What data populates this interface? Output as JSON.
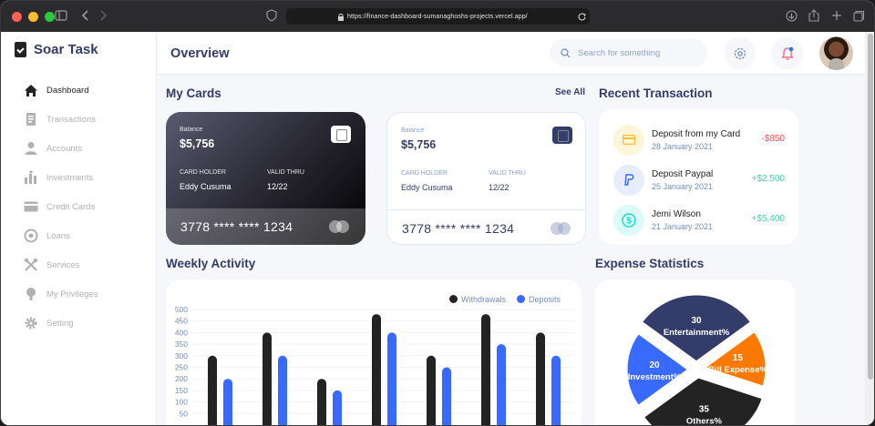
{
  "browser": {
    "url": "https://finance-dashboard-sumanaghoshs-projects.vercel.app/"
  },
  "sidebar": {
    "brand": "Soar Task",
    "items": [
      {
        "label": "Dashboard",
        "icon": "home-icon",
        "active": true
      },
      {
        "label": "Transactions",
        "icon": "transfer-icon",
        "active": false
      },
      {
        "label": "Accounts",
        "icon": "user-icon",
        "active": false
      },
      {
        "label": "Investments",
        "icon": "investment-icon",
        "active": false
      },
      {
        "label": "Credit Cards",
        "icon": "credit-card-icon",
        "active": false
      },
      {
        "label": "Loans",
        "icon": "loan-icon",
        "active": false
      },
      {
        "label": "Services",
        "icon": "services-icon",
        "active": false
      },
      {
        "label": "My Privileges",
        "icon": "privileges-icon",
        "active": false
      },
      {
        "label": "Setting",
        "icon": "gear-icon",
        "active": false
      }
    ]
  },
  "header": {
    "title": "Overview",
    "search_placeholder": "Search for something"
  },
  "my_cards": {
    "title": "My Cards",
    "see_all": "See All",
    "cards": [
      {
        "balance_label": "Balance",
        "balance": "$5,756",
        "holder_label": "CARD HOLDER",
        "holder": "Eddy Cusuma",
        "valid_label": "VALID THRU",
        "valid": "12/22",
        "number": "3778 **** **** 1234",
        "theme": "dark"
      },
      {
        "balance_label": "Balance",
        "balance": "$5,756",
        "holder_label": "CARD HOLDER",
        "holder": "Eddy Cusuma",
        "valid_label": "VALID THRU",
        "valid": "12/22",
        "number": "3778 **** **** 1234",
        "theme": "light"
      }
    ]
  },
  "recent_transactions": {
    "title": "Recent Transaction",
    "items": [
      {
        "name": "Deposit from my Card",
        "date": "28 January 2021",
        "amount": "-$850",
        "color": "#ff4b4a",
        "icon": "card-icon",
        "icon_bg": "#fff5d9"
      },
      {
        "name": "Deposit Paypal",
        "date": "25 January 2021",
        "amount": "+$2,500",
        "color": "#41d4a8",
        "icon": "paypal-icon",
        "icon_bg": "#e7edff"
      },
      {
        "name": "Jemi Wilson",
        "date": "21 January 2021",
        "amount": "+$5,400",
        "color": "#41d4a8",
        "icon": "dollar-icon",
        "icon_bg": "#dcfaf8"
      }
    ]
  },
  "weekly_activity": {
    "title": "Weekly Activity",
    "legend": [
      "Withdrawals",
      "Deposits"
    ],
    "colors": {
      "withdrawals": "#232323",
      "deposits": "#396aff"
    },
    "chart_data": {
      "type": "bar",
      "series": [
        {
          "name": "Withdrawals",
          "values": [
            300,
            400,
            200,
            480,
            300,
            480,
            400
          ]
        },
        {
          "name": "Deposits",
          "values": [
            200,
            300,
            150,
            400,
            250,
            350,
            300
          ]
        }
      ],
      "yticks": [
        500,
        450,
        400,
        350,
        300,
        250,
        200,
        150,
        100,
        50
      ],
      "ylim": [
        0,
        500
      ]
    }
  },
  "expense_statistics": {
    "title": "Expense Statistics",
    "chart_data": {
      "type": "pie",
      "slices": [
        {
          "label": "Entertainment%",
          "value": 30,
          "color": "#343c6a"
        },
        {
          "label": "Bill Expense%",
          "value": 15,
          "color": "#fc7900"
        },
        {
          "label": "Others%",
          "value": 35,
          "color": "#232323"
        },
        {
          "label": "Investment%",
          "value": 20,
          "color": "#396aff"
        }
      ]
    }
  }
}
